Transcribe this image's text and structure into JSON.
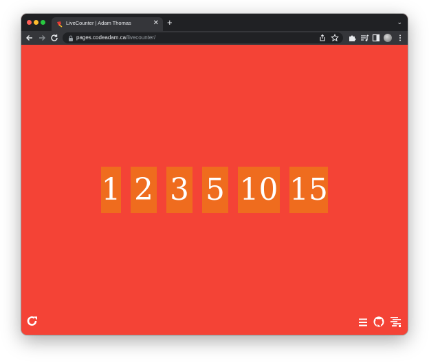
{
  "browser": {
    "tab": {
      "title": "LiveCounter | Adam Thomas",
      "close_glyph": "✕"
    },
    "new_tab_glyph": "+",
    "tab_menu_glyph": "⌄",
    "address": {
      "host": "pages.codeadam.ca",
      "path": "/livecounter/"
    }
  },
  "page": {
    "background_color": "#f44336",
    "counter_color": "#ef6c1e",
    "counters": [
      "1",
      "2",
      "3",
      "5",
      "10",
      "15"
    ]
  },
  "icons": {
    "back": "arrow-left-icon",
    "forward": "arrow-right-icon",
    "reload": "reload-icon",
    "share": "share-icon",
    "bookmark": "star-icon",
    "extensions": "puzzle-icon",
    "media": "media-queue-icon",
    "sidebar": "side-panel-icon",
    "menu": "kebab-menu-icon",
    "page_refresh": "refresh-icon",
    "page_menu": "hamburger-menu-icon",
    "github": "github-icon",
    "codeadam": "codeadam-logo-icon"
  }
}
